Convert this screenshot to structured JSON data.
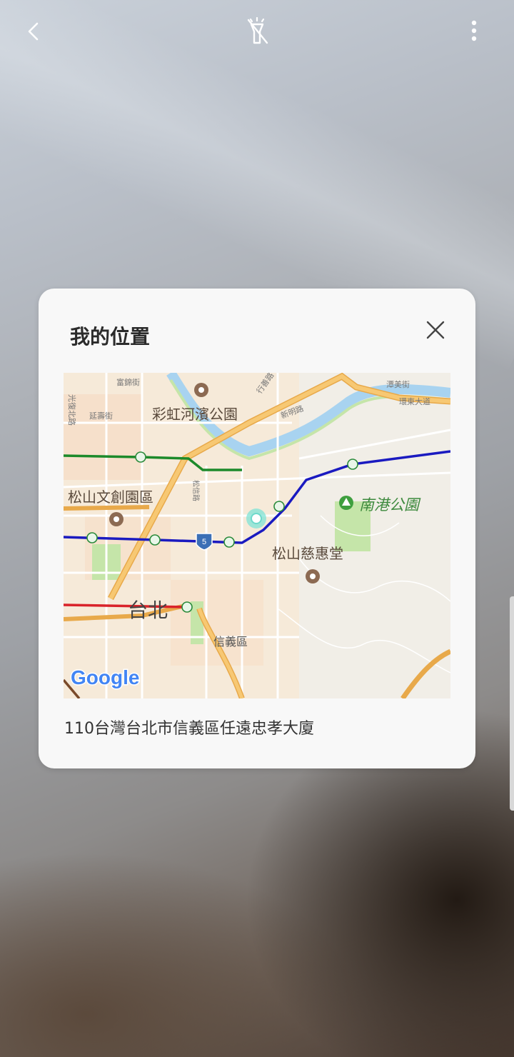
{
  "topbar": {
    "back_icon": "chevron-left-icon",
    "flash_icon": "flashlight-off-icon",
    "more_icon": "more-vertical-icon"
  },
  "card": {
    "title": "我的位置",
    "close_icon": "close-icon",
    "address": "110台灣台北市信義區任遠忠孝大廈"
  },
  "map": {
    "labels": {
      "park_rainbow": "彩虹河濱公園",
      "songshan_culture": "松山文創園區",
      "nangang_park": "南港公園",
      "songshan_temple": "松山慈惠堂",
      "taipei": "台北",
      "xinyi": "信義區",
      "fujin": "富錦街",
      "yanshou": "延壽街",
      "guangfu": "光復北路",
      "xingshan": "行善路",
      "xinming": "新明路",
      "huanmei": "潭美街",
      "huandong": "環東大道",
      "songxin": "松信路",
      "route_no": "5"
    },
    "logo": "Google",
    "colors": {
      "blue_line": "#1a1ac0",
      "green_line": "#1c8a2a",
      "red_line": "#d9232a",
      "highway": "#f5b85a",
      "river": "#a8d3f0",
      "park": "#c5e5a9"
    }
  }
}
